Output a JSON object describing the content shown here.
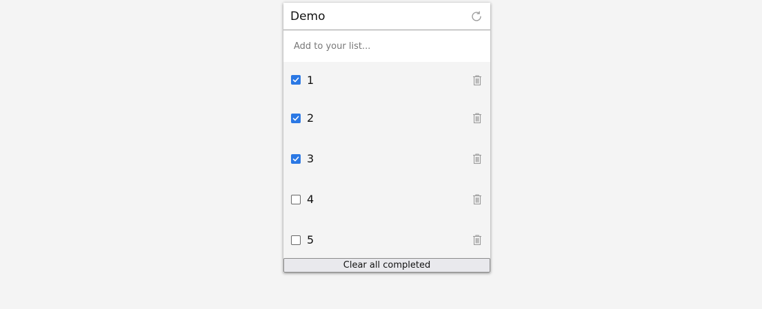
{
  "header": {
    "title": "Demo",
    "refresh_icon": "refresh-icon"
  },
  "add": {
    "placeholder": "Add to your list..."
  },
  "items": [
    {
      "label": "1",
      "checked": true
    },
    {
      "label": "2",
      "checked": true
    },
    {
      "label": "3",
      "checked": true
    },
    {
      "label": "4",
      "checked": false
    },
    {
      "label": "5",
      "checked": false
    }
  ],
  "footer": {
    "clear_label": "Clear all completed"
  },
  "colors": {
    "accent": "#2b78e4",
    "icon": "#9a9a9a"
  }
}
